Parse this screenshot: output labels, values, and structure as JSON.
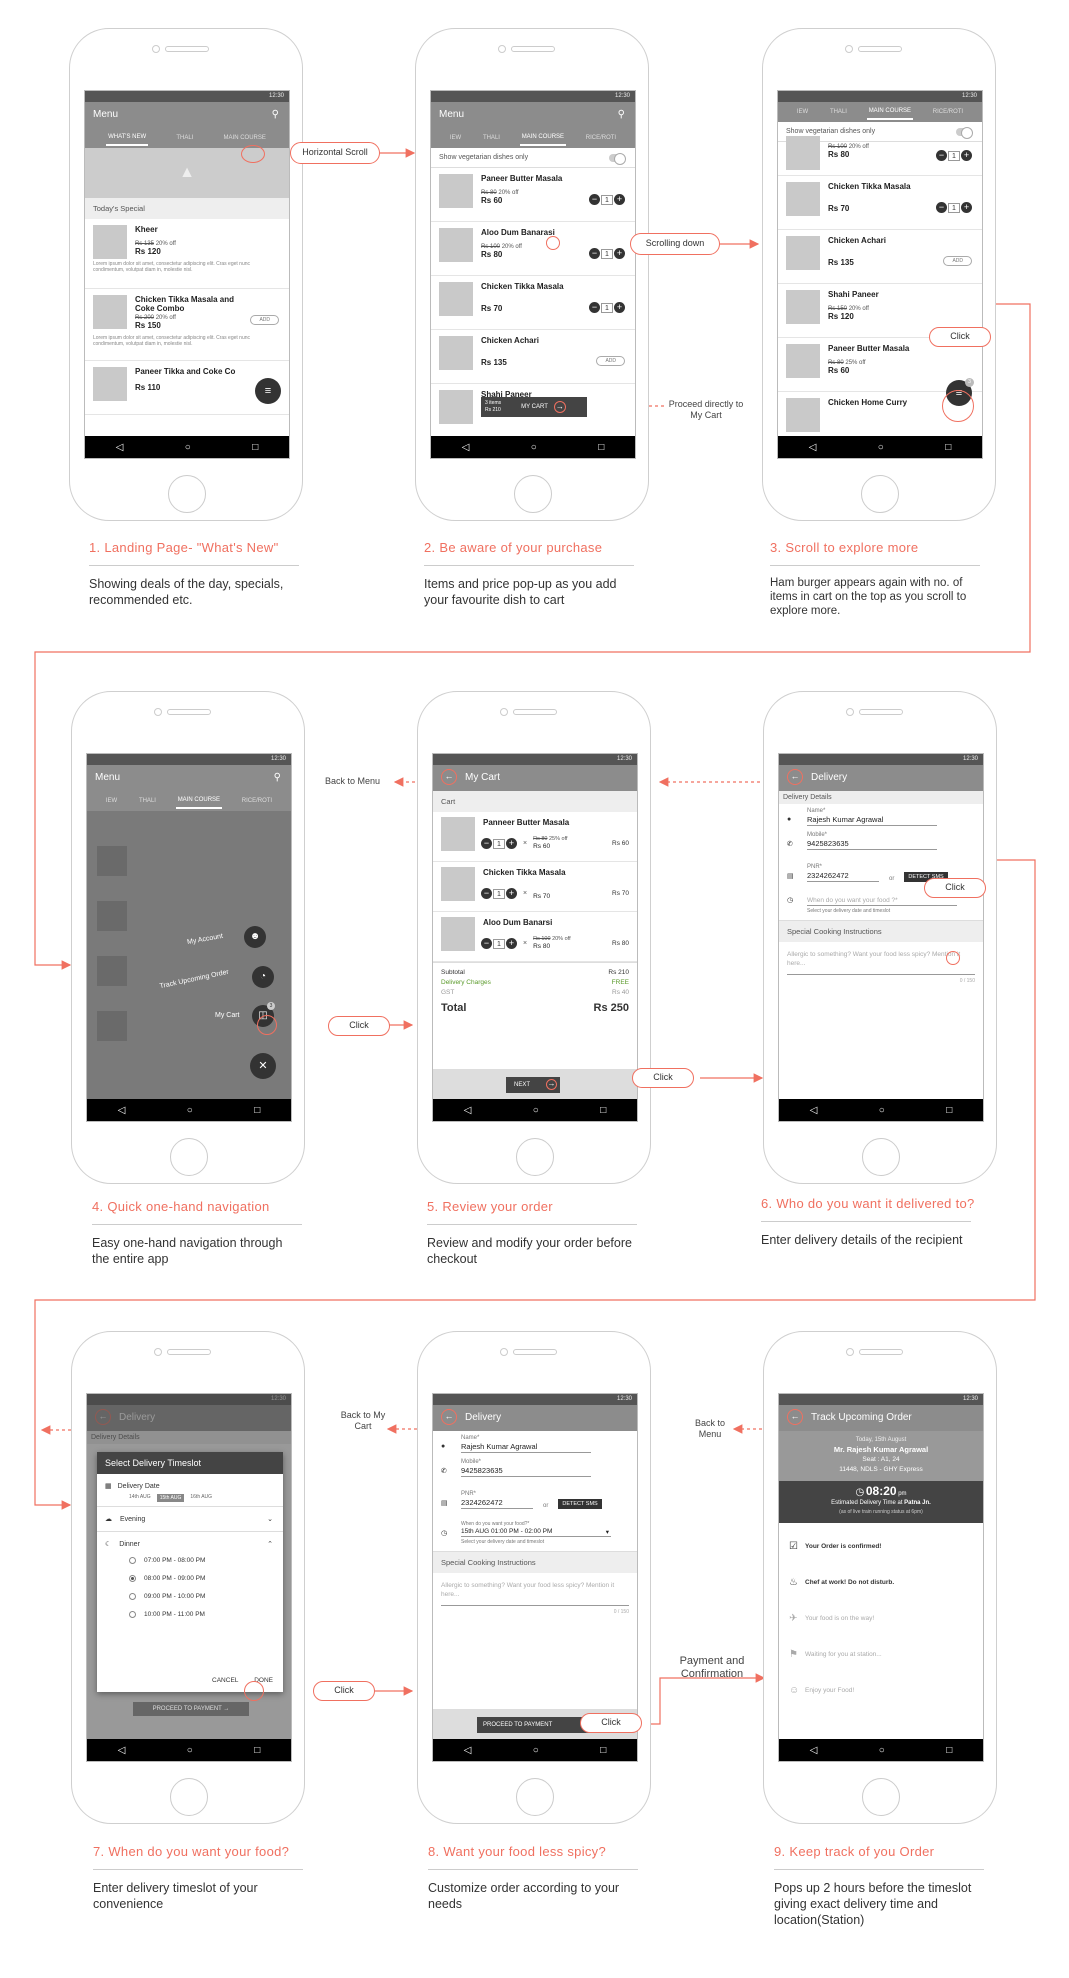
{
  "status_time": "12:30",
  "connectors": {
    "horizontal_scroll": "Horizontal Scroll",
    "scrolling_down": "Scrolling down",
    "proceed_directly": "Proceed directly to My Cart",
    "click": "Click",
    "back_to_menu": "Back to Menu",
    "back_to_my_cart": "Back to My Cart",
    "payment_confirmation": "Payment and Confirmation"
  },
  "steps": [
    {
      "title": "1. Landing Page- \"What's New\"",
      "desc": "Showing deals of the day, specials, recommended etc."
    },
    {
      "title": "2. Be aware of your purchase",
      "desc": "Items and price pop-up as you add your favourite dish to cart"
    },
    {
      "title": "3. Scroll to explore more",
      "desc": "Ham burger appears again with no. of items in cart on the top as you scroll to explore more."
    },
    {
      "title": "4. Quick one-hand navigation",
      "desc": "Easy one-hand navigation through the entire app"
    },
    {
      "title": "5. Review your order",
      "desc": "Review and modify your order before checkout"
    },
    {
      "title": "6. Who do you want it delivered to?",
      "desc": "Enter delivery details of the recipient"
    },
    {
      "title": "7. When do you want your food?",
      "desc": "Enter delivery timeslot of your convenience"
    },
    {
      "title": "8. Want your food less spicy?",
      "desc": "Customize order according to your needs"
    },
    {
      "title": "9. Keep track of you Order",
      "desc": "Pops up 2 hours before the timeslot giving exact delivery time and location(Station)"
    }
  ],
  "menu": {
    "title": "Menu",
    "tabs": [
      "WHAT'S NEW",
      "THALI",
      "MAIN COURSE"
    ],
    "tabs_scrolled": [
      "IEW",
      "THALI",
      "MAIN COURSE",
      "RICE/ROTI"
    ],
    "veg_only": "Show vegetarian dishes only",
    "todays_special": "Today's Special",
    "lorem": "Lorem ipsum dolor sit amet, consectetur adipiscing elit. Cras eget nunc condimentum, volutpat diam in, molestie nisl.",
    "add": "ADD"
  },
  "s1": {
    "items": [
      {
        "name": "Kheer",
        "old": "Rs 135",
        "off": "20% off",
        "price": "Rs 120"
      },
      {
        "name": "Chicken Tikka Masala and Coke Combo",
        "old": "Rs 200",
        "off": "20% off",
        "price": "Rs 150"
      },
      {
        "name": "Paneer Tikka and Coke Co",
        "old": "",
        "off": "",
        "price": "Rs 110"
      }
    ]
  },
  "s2": {
    "items": [
      {
        "name": "Paneer Butter Masala",
        "old": "Rs 80",
        "off": "20% off",
        "price": "Rs 60",
        "qty": "1"
      },
      {
        "name": "Aloo Dum Banarasi",
        "old": "Rs 100",
        "off": "20% off",
        "price": "Rs 80",
        "qty": "1"
      },
      {
        "name": "Chicken Tikka Masala",
        "old": "",
        "off": "",
        "price": "Rs 70",
        "qty": "1"
      },
      {
        "name": "Chicken Achari",
        "old": "",
        "off": "",
        "price": "Rs 135",
        "qty": ""
      },
      {
        "name": "Shahi Paneer",
        "old": "",
        "off": "",
        "price": "",
        "qty": ""
      }
    ],
    "cart_items": "3 items",
    "cart_total": "Rs 210",
    "my_cart": "MY CART"
  },
  "s3": {
    "items": [
      {
        "name": "",
        "old": "Rs 100",
        "off": "20% off",
        "price": "Rs 80",
        "qty": "1"
      },
      {
        "name": "Chicken Tikka Masala",
        "old": "",
        "off": "",
        "price": "Rs 70",
        "qty": "1"
      },
      {
        "name": "Chicken Achari",
        "old": "",
        "off": "",
        "price": "Rs 135",
        "qty": ""
      },
      {
        "name": "Shahi Paneer",
        "old": "Rs 150",
        "off": "20% off",
        "price": "Rs 120",
        "qty": ""
      },
      {
        "name": "Paneer Butter Masala",
        "old": "Rs 80",
        "off": "25% off",
        "price": "Rs 60",
        "qty": ""
      },
      {
        "name": "Chicken Home Curry",
        "old": "",
        "off": "",
        "price": "",
        "qty": ""
      }
    ],
    "badge": "3"
  },
  "s4": {
    "my_account": "My Account",
    "track": "Track Upcoming Order",
    "my_cart": "My Cart",
    "badge": "3"
  },
  "cart": {
    "title": "My Cart",
    "section": "Cart",
    "items": [
      {
        "name": "Panneer Butter Masala",
        "qty": "1",
        "old": "Rs 80",
        "off": "25% off",
        "unit": "Rs 60",
        "total": "Rs 60"
      },
      {
        "name": "Chicken Tikka Masala",
        "qty": "1",
        "old": "",
        "off": "",
        "unit": "Rs 70",
        "total": "Rs 70"
      },
      {
        "name": "Aloo Dum Banarsi",
        "qty": "1",
        "old": "Rs 100",
        "off": "20% off",
        "unit": "Rs 80",
        "total": "Rs 80"
      }
    ],
    "subtotal_label": "Subtotal",
    "subtotal": "Rs 210",
    "delivery_label": "Delivery Charges",
    "delivery": "FREE",
    "gst_label": "GST",
    "gst": "Rs 40",
    "total_label": "Total",
    "total": "Rs 250",
    "next": "NEXT"
  },
  "delivery": {
    "title": "Delivery",
    "details": "Delivery Details",
    "name_label": "Name*",
    "name": "Rajesh Kumar Agrawal",
    "mobile_label": "Mobile*",
    "mobile": "9425823635",
    "pnr_label": "PNR*",
    "pnr": "2324262472",
    "or": "or",
    "detect": "DETECT SMS",
    "when_placeholder": "When do you want your food ?*",
    "when_hint": "Select your delivery date and timeslot",
    "when_label": "When do you want your food?*",
    "when_value": "15th AUG    01:00 PM - 02:00 PM",
    "special": "Special Cooking Instructions",
    "special_placeholder": "Allergic to something? Want your food less spicy? Mention it here...",
    "counter": "0 / 150",
    "proceed": "PROCEED TO PAYMENT"
  },
  "timeslot": {
    "title": "Select Delivery Timeslot",
    "date_label": "Delivery Date",
    "dates": [
      "14th AUG",
      "15th AUG",
      "16th AUG"
    ],
    "evening": "Evening",
    "dinner": "Dinner",
    "slots": [
      "07:00 PM - 08:00 PM",
      "08:00 PM - 09:00 PM",
      "09:00 PM - 10:00 PM",
      "10:00 PM - 11:00 PM"
    ],
    "cancel": "CANCEL",
    "done": "DONE"
  },
  "track": {
    "title": "Track Upcoming Order",
    "date": "Today, 15th August",
    "name": "Mr. Rajesh Kumar Agrawal",
    "seat": "Seat : A1, 24",
    "train": "11448, NDLS - GHY Express",
    "time": "08:20",
    "ampm": "pm",
    "est": "Estimated Delivery Time at",
    "station": "Patna Jn.",
    "note": "(as of live train running status at 6pm)",
    "statuses": [
      "Your Order is confirmed!",
      "Chef at work! Do not disturb.",
      "Your food is on the way!",
      "Waiting for you at station...",
      "Enjoy your Food!"
    ]
  },
  "colors": {
    "accent": "#f07060",
    "appbar": "#8c8c8c",
    "dark": "#333333"
  }
}
